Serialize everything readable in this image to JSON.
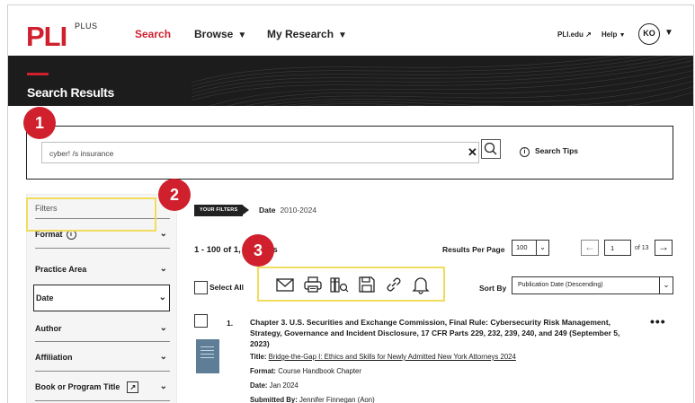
{
  "nav": {
    "logo": "PLI",
    "logo_sup": "PLUS",
    "search": "Search",
    "browse": "Browse",
    "my_research": "My Research",
    "pli_edu": "PLI.edu ↗",
    "help": "Help",
    "avatar": "KO"
  },
  "banner": {
    "title": "Search Results"
  },
  "search": {
    "query": "cyber! /s insurance",
    "tips": "Search Tips"
  },
  "badges": {
    "one": "1",
    "two": "2",
    "three": "3"
  },
  "filters": {
    "heading": "Filters",
    "facets": [
      "Format",
      "Practice Area",
      "Date",
      "Author",
      "Affiliation",
      "Book or Program Title"
    ]
  },
  "your_filters": {
    "tag": "YOUR FILTERS",
    "date_label": "Date",
    "date_value": "2010-2024"
  },
  "results": {
    "count_start": "1 - 100 of 1,",
    "count_end": "ults",
    "per_page_label": "Results Per Page",
    "per_page": "100",
    "page": "1",
    "of_pages": "of 13",
    "select_all": "Select All",
    "sort_label": "Sort By",
    "sort_value": "Publication Date (Descending)",
    "tools": [
      "email-icon",
      "print-icon",
      "books-icon",
      "save-icon",
      "link-icon",
      "bell-icon"
    ]
  },
  "result1": {
    "num": "1.",
    "title": "Chapter 3. U.S. Securities and Exchange Commission, Final Rule: Cybersecurity Risk Management, Strategy, Governance and Incident Disclosure, 17 CFR Parts 229, 232, 239, 240, and 249 (September 5, 2023)",
    "title_label": "Title:",
    "title_value": "Bridge-the-Gap I: Ethics and Skills for Newly Admitted New York Attorneys 2024",
    "format_label": "Format:",
    "format_value": "Course Handbook Chapter",
    "date_label": "Date:",
    "date_value": "Jan 2024",
    "submitted_label": "Submitted By:",
    "submitted_value": "Jennifer Finnegan (Aon)"
  },
  "colors": {
    "brand_red": "#d0202e",
    "highlight": "#f2dc5d",
    "banner": "#1c1c1c"
  }
}
